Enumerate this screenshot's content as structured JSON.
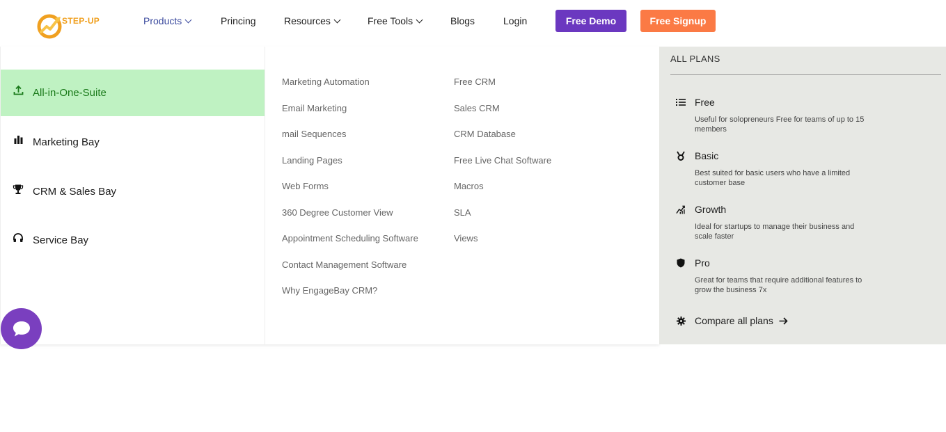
{
  "brand": {
    "name": "STEP-UP",
    "colors": {
      "orange": "#f0a020",
      "primary": "#6b38c0",
      "accent": "#fb7a45",
      "active_green": "#bff2c2"
    }
  },
  "nav": {
    "products": "Products",
    "pricing": "Princing",
    "resources": "Resources",
    "free_tools": "Free Tools",
    "blogs": "Blogs",
    "login": "Login",
    "free_demo": "Free Demo",
    "free_signup": "Free Signup"
  },
  "categories": [
    {
      "label": "All-in-One-Suite",
      "icon": "upload-icon",
      "active": true
    },
    {
      "label": "Marketing Bay",
      "icon": "bar-chart-icon",
      "active": false
    },
    {
      "label": "CRM & Sales Bay",
      "icon": "trophy-icon",
      "active": false
    },
    {
      "label": "Service Bay",
      "icon": "headphones-icon",
      "active": false
    }
  ],
  "links_col1": [
    "Marketing Automation",
    "Email Marketing",
    "mail Sequences",
    "Landing Pages",
    "Web Forms",
    "360 Degree Customer View",
    "Appointment Scheduling Software",
    "Contact Management Software",
    "Why EngageBay CRM?"
  ],
  "links_col2": [
    "Free CRM",
    "Sales CRM",
    "CRM Database",
    "Free Live Chat Software",
    "Macros",
    "SLA",
    "Views"
  ],
  "plans": {
    "title": "ALL PLANS",
    "items": [
      {
        "name": "Free",
        "icon": "list-icon",
        "desc": "Useful for solopreneurs Free for teams of up to 15 members"
      },
      {
        "name": "Basic",
        "icon": "medal-icon",
        "desc": "Best suited for basic users who have a limited customer base"
      },
      {
        "name": "Growth",
        "icon": "growth-chart-icon",
        "desc": "Ideal for startups to manage their business and scale faster"
      },
      {
        "name": "Pro",
        "icon": "shield-icon",
        "desc": "Great for teams that require additional features to grow the business 7x"
      }
    ],
    "compare": "Compare all plans"
  }
}
